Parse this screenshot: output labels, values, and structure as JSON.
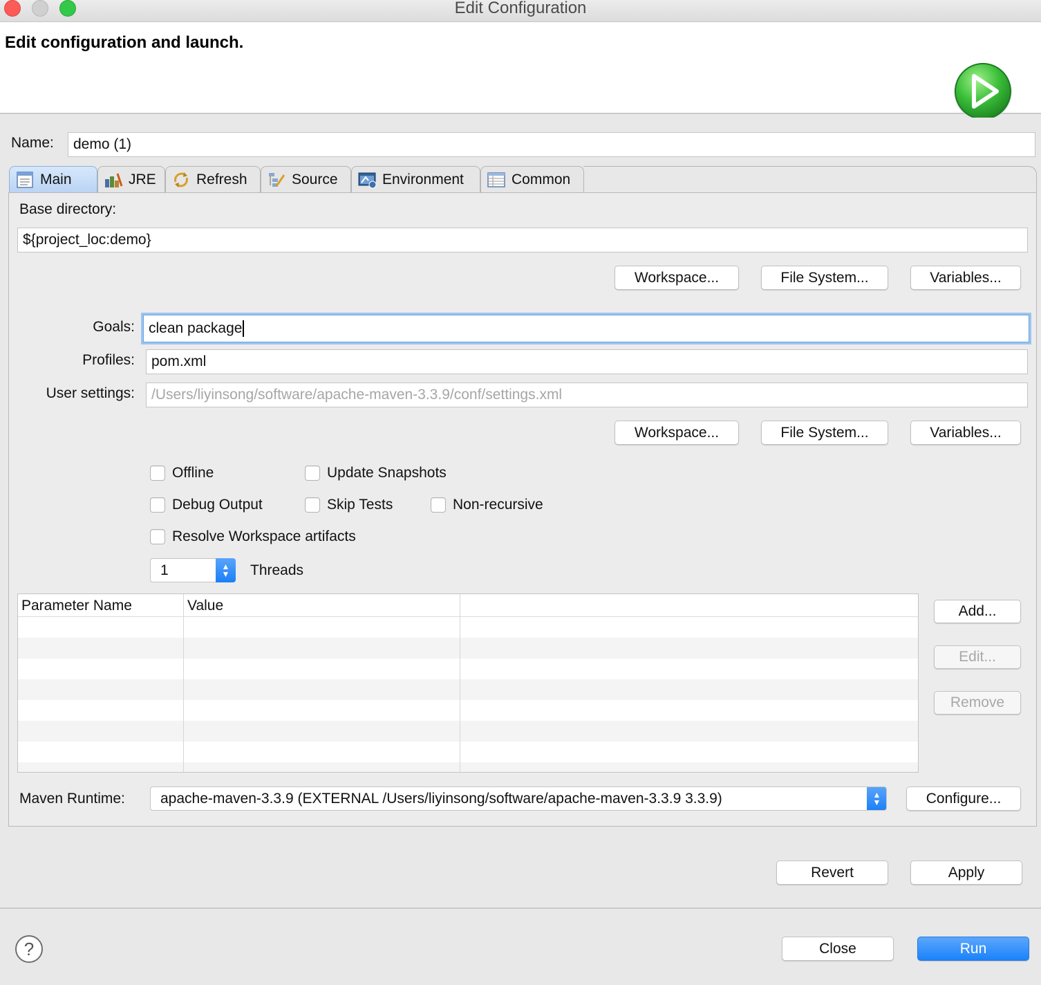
{
  "window": {
    "title": "Edit Configuration"
  },
  "banner": {
    "title": "Edit configuration and launch.",
    "icon": "run-launch-icon",
    "icon_color": "#2fb63c"
  },
  "name": {
    "label": "Name:",
    "value": "demo (1)"
  },
  "tabs": [
    {
      "label": "Main",
      "icon": "main-tab-icon",
      "active": true
    },
    {
      "label": "JRE",
      "icon": "jre-icon",
      "active": false
    },
    {
      "label": "Refresh",
      "icon": "refresh-icon",
      "active": false
    },
    {
      "label": "Source",
      "icon": "source-icon",
      "active": false
    },
    {
      "label": "Environment",
      "icon": "environment-icon",
      "active": false
    },
    {
      "label": "Common",
      "icon": "common-icon",
      "active": false
    }
  ],
  "main": {
    "base_directory": {
      "label": "Base directory:",
      "value": "${project_loc:demo}",
      "buttons": {
        "workspace": "Workspace...",
        "file_system": "File System...",
        "variables": "Variables..."
      }
    },
    "goals": {
      "label": "Goals:",
      "value": "clean package"
    },
    "profiles": {
      "label": "Profiles:",
      "value": "pom.xml"
    },
    "user_settings": {
      "label": "User settings:",
      "placeholder": "/Users/liyinsong/software/apache-maven-3.3.9/conf/settings.xml",
      "buttons": {
        "workspace": "Workspace...",
        "file_system": "File System...",
        "variables": "Variables..."
      }
    },
    "options": {
      "offline": {
        "label": "Offline",
        "checked": false
      },
      "update_snapshots": {
        "label": "Update Snapshots",
        "checked": false
      },
      "debug_output": {
        "label": "Debug Output",
        "checked": false
      },
      "skip_tests": {
        "label": "Skip Tests",
        "checked": false
      },
      "non_recursive": {
        "label": "Non-recursive",
        "checked": false
      },
      "resolve_workspace": {
        "label": "Resolve Workspace artifacts",
        "checked": false
      }
    },
    "threads": {
      "value": "1",
      "label": "Threads"
    },
    "parameters": {
      "columns": [
        "Parameter Name",
        "Value",
        ""
      ],
      "rows": [],
      "buttons": {
        "add": "Add...",
        "edit": "Edit...",
        "remove": "Remove"
      }
    },
    "maven_runtime": {
      "label": "Maven Runtime:",
      "value": "apache-maven-3.3.9 (EXTERNAL /Users/liyinsong/software/apache-maven-3.3.9 3.3.9)",
      "configure": "Configure..."
    },
    "revert": "Revert",
    "apply": "Apply"
  },
  "footer": {
    "help": "?",
    "close": "Close",
    "run": "Run",
    "run_color": "#1a82fb"
  }
}
